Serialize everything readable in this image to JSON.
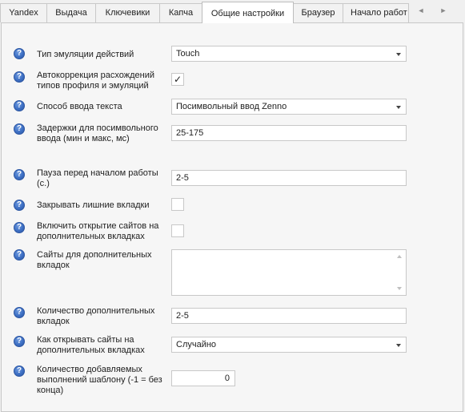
{
  "tabs": [
    {
      "label": "Yandex"
    },
    {
      "label": "Выдача"
    },
    {
      "label": "Ключевики"
    },
    {
      "label": "Капча"
    },
    {
      "label": "Общие настройки"
    },
    {
      "label": "Браузер"
    },
    {
      "label": "Начало работ"
    }
  ],
  "active_tab": "Общие настройки",
  "scroll": {
    "left": "◄",
    "right": "►"
  },
  "help_glyph": "?",
  "fields": {
    "emulation_type": {
      "label": "Тип эмуляции действий",
      "value": "Touch"
    },
    "autocorrect": {
      "label": "Автокоррекция расхождений типов профиля и эмуляций",
      "checked": true,
      "glyph": "✓"
    },
    "input_method": {
      "label": "Способ ввода текста",
      "value": "Посимвольный ввод Zenno"
    },
    "input_delays": {
      "label": "Задержки для посимвольного ввода (мин и макс, мс)",
      "value": "25-175"
    },
    "pause_before_start": {
      "label": "Пауза перед началом работы (с.)",
      "value": "2-5"
    },
    "close_extra_tabs": {
      "label": "Закрывать лишние вкладки",
      "checked": false
    },
    "open_sites_extra_tabs": {
      "label": "Включить открытие сайтов на дополнительных вкладках",
      "checked": false
    },
    "extra_tab_sites": {
      "label": "Сайты для дополнительных вкладок",
      "value": ""
    },
    "extra_tab_count": {
      "label": "Количество дополнительных вкладок",
      "value": "2-5"
    },
    "open_method": {
      "label": "Как открывать сайты на дополнительных вкладках",
      "value": "Случайно"
    },
    "template_runs": {
      "label": "Количество добавляемых выполнений шаблону (-1 = без конца)",
      "value": "0"
    }
  },
  "colors": {
    "help_icon": "#3d6fc3",
    "panel_bg": "#f6f6f6",
    "field_border": "#c8c8c8"
  }
}
